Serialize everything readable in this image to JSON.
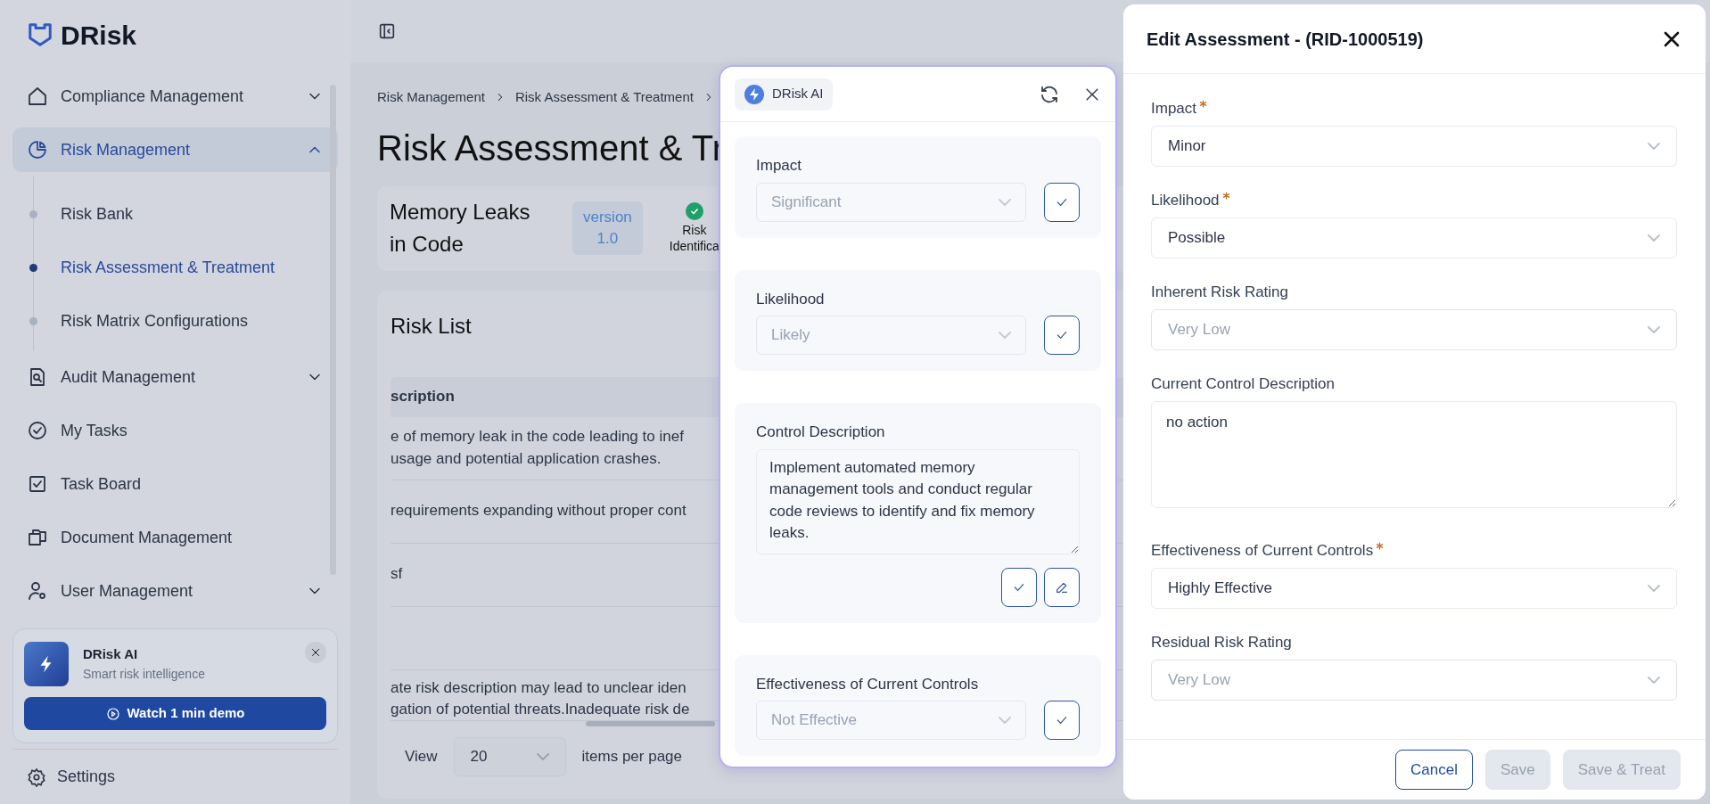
{
  "sidebar": {
    "logo": "DRisk",
    "items": [
      {
        "label": "Compliance Management",
        "selected": false,
        "expanded": false
      },
      {
        "label": "Risk Management",
        "selected": true,
        "expanded": true,
        "children": [
          {
            "label": "Risk Bank",
            "selected": false
          },
          {
            "label": "Risk Assessment & Treatment",
            "selected": true
          },
          {
            "label": "Risk Matrix Configurations",
            "selected": false
          }
        ]
      },
      {
        "label": "Audit Management",
        "selected": false,
        "expanded": false
      },
      {
        "label": "My Tasks",
        "selected": false
      },
      {
        "label": "Task Board",
        "selected": false
      },
      {
        "label": "Document Management",
        "selected": false
      },
      {
        "label": "User Management",
        "selected": false,
        "expanded": false
      }
    ],
    "promo": {
      "title": "DRisk AI",
      "subtitle": "Smart risk intelligence",
      "button": "Watch 1 min demo"
    },
    "settings": "Settings"
  },
  "main": {
    "breadcrumb": [
      "Risk Management",
      "Risk Assessment & Treatment"
    ],
    "title": "Risk Assessment & Tr",
    "risk": {
      "name": "Memory Leaks in Code",
      "version": [
        "version",
        "1.0"
      ],
      "steps": [
        {
          "label": [
            "Risk",
            "Identifica"
          ],
          "done": true
        }
      ]
    },
    "risk_list": {
      "title": "Risk List",
      "column": "scription",
      "rows": [
        [
          "e of memory leak in the code leading to inef",
          "usage and potential application crashes."
        ],
        [
          "requirements expanding without proper cont"
        ],
        [
          "sf"
        ],
        [],
        [
          "ate risk description may lead to unclear iden",
          "gation of potential threats.Inadequate risk de"
        ]
      ],
      "pagination": {
        "label": "View",
        "value": "20",
        "suffix": "items per page"
      }
    }
  },
  "ai_panel": {
    "title": "DRisk AI",
    "sections": [
      {
        "kind": "select",
        "label": "Impact",
        "value": "Significant",
        "disabled": true
      },
      {
        "kind": "select",
        "label": "Likelihood",
        "value": "Likely",
        "disabled": true
      },
      {
        "kind": "textarea",
        "label": "Control Description",
        "value": "Implement automated memory management tools and conduct regular code reviews to identify and fix memory leaks."
      },
      {
        "kind": "select",
        "label": "Effectiveness of Current Controls",
        "value": "Not Effective",
        "disabled": true
      }
    ]
  },
  "edit_panel": {
    "title": "Edit Assessment - (RID-1000519)",
    "fields": [
      {
        "kind": "select",
        "label": "Impact",
        "required": true,
        "value": "Minor",
        "disabled": false
      },
      {
        "kind": "select",
        "label": "Likelihood",
        "required": true,
        "value": "Possible",
        "disabled": false
      },
      {
        "kind": "select",
        "label": "Inherent Risk Rating",
        "required": false,
        "value": "Very Low",
        "disabled": true
      },
      {
        "kind": "textarea",
        "label": "Current Control Description",
        "required": false,
        "value": "no action"
      },
      {
        "kind": "select",
        "label": "Effectiveness of Current Controls",
        "required": true,
        "value": "Highly Effective",
        "disabled": false
      },
      {
        "kind": "select",
        "label": "Residual Risk Rating",
        "required": false,
        "value": "Very Low",
        "disabled": true
      }
    ],
    "buttons": [
      {
        "label": "Cancel",
        "disabled": false
      },
      {
        "label": "Save",
        "disabled": true
      },
      {
        "label": "Save & Treat",
        "disabled": true
      }
    ]
  }
}
